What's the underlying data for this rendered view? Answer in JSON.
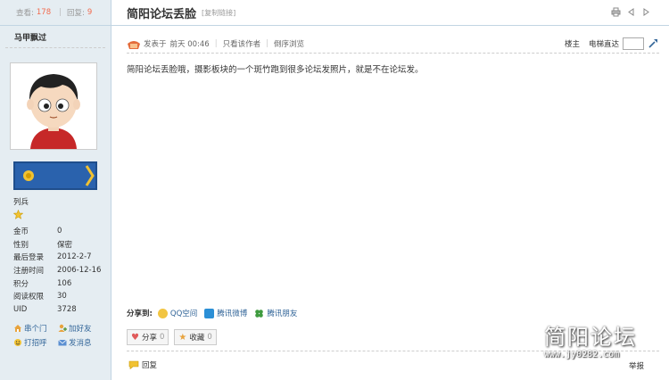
{
  "thread_stats": {
    "views_label": "查看:",
    "views": "178",
    "replies_label": "回复:",
    "replies": "9"
  },
  "author": {
    "name": "马甲飘过",
    "rank": "列兵",
    "fields": [
      {
        "k": "金币",
        "v": "0"
      },
      {
        "k": "性别",
        "v": "保密"
      },
      {
        "k": "最后登录",
        "v": "2012-2-7"
      },
      {
        "k": "注册时间",
        "v": "2006-12-16"
      },
      {
        "k": "积分",
        "v": "106"
      },
      {
        "k": "阅读权限",
        "v": "30"
      },
      {
        "k": "UID",
        "v": "3728"
      }
    ],
    "actions": {
      "visit": "串个门",
      "add_friend": "加好友",
      "greet": "打招呼",
      "message": "发消息"
    }
  },
  "thread": {
    "title": "简阳论坛丢脸",
    "copy_link": "[复制链接]"
  },
  "post": {
    "posted_prefix": "发表于",
    "posted_time": "前天 00:46",
    "only_author": "只看该作者",
    "reverse": "倒序浏览",
    "floor_label": "楼主",
    "jump_label": "电梯直达",
    "content": "简阳论坛丢脸哦，摄影板块的一个斑竹跑到很多论坛发照片，就是不在论坛发。"
  },
  "share": {
    "label": "分享到:",
    "items": [
      "QQ空间",
      "腾讯微博",
      "腾讯朋友"
    ]
  },
  "buttons": {
    "share_label": "分享",
    "share_count": "0",
    "fav_label": "收藏",
    "fav_count": "0"
  },
  "footer": {
    "reply": "回复",
    "report": "举报"
  },
  "watermark": {
    "title": "简阳论坛",
    "url": "www.jy0282.com"
  }
}
